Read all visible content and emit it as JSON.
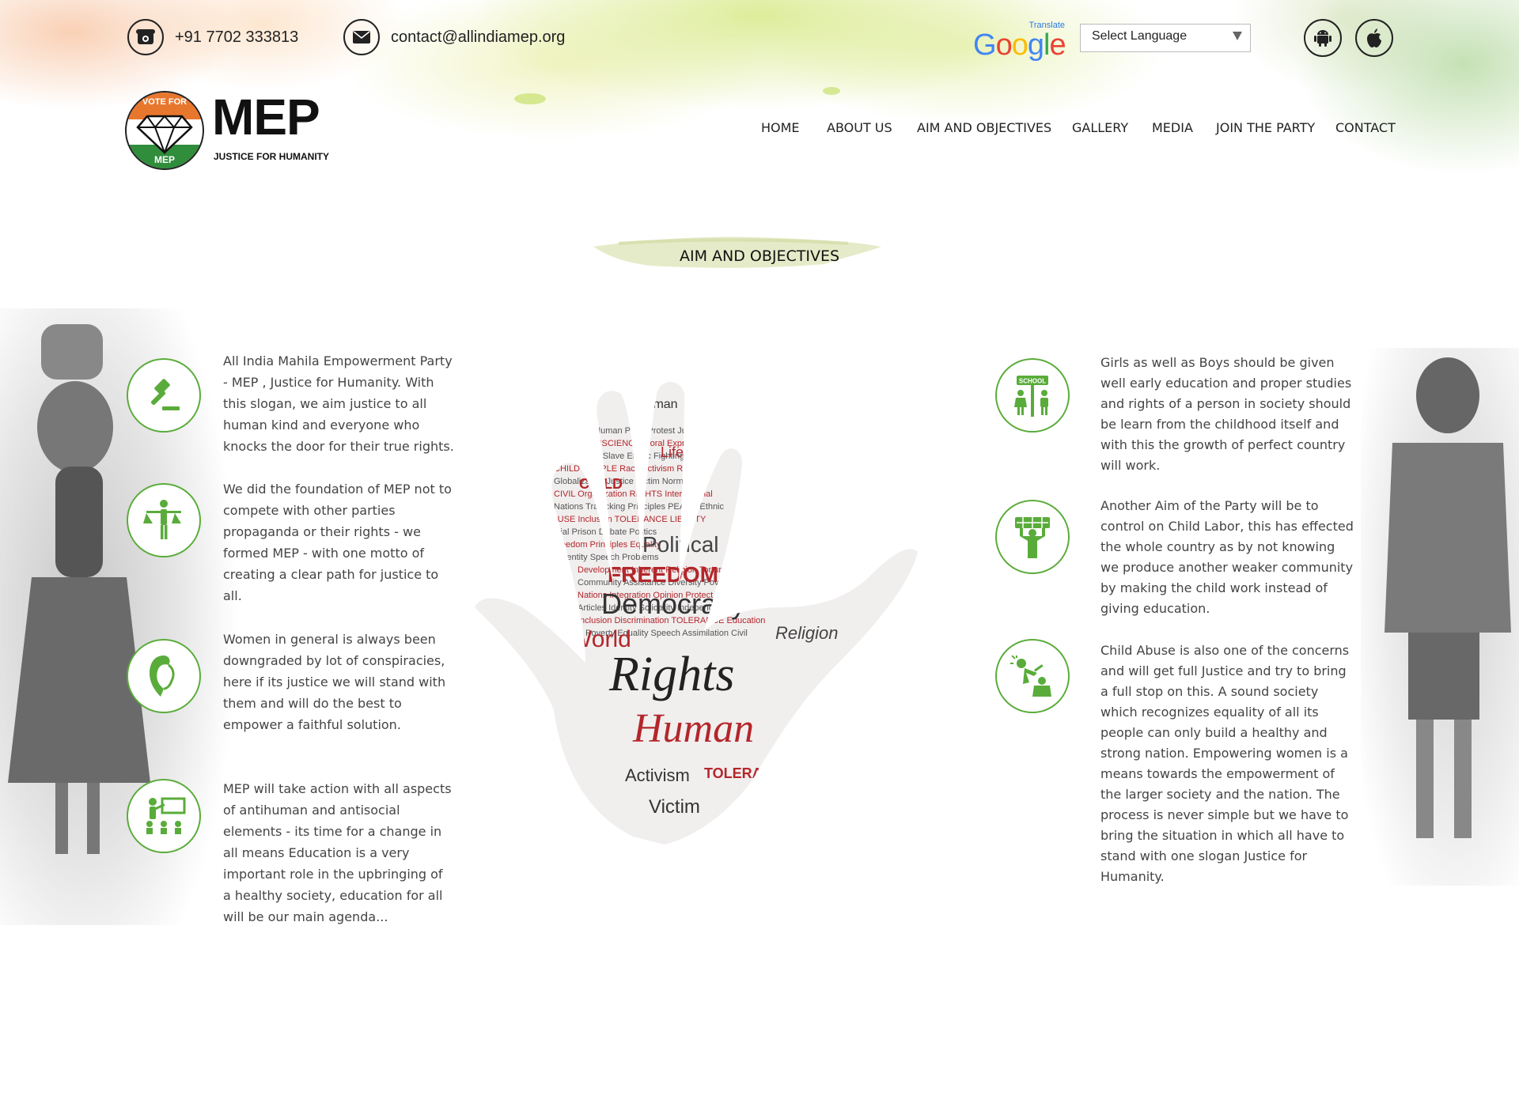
{
  "topbar": {
    "phone": "+91 7702 333813",
    "email": "contact@allindiamep.org",
    "translate_label": "Translate",
    "google_label": "Google",
    "language_select": "Select Language"
  },
  "icons": {
    "phone": "phone-icon",
    "email": "envelope-icon",
    "android": "android-icon",
    "apple": "apple-icon"
  },
  "logo": {
    "vote_for": "VOTE FOR",
    "badge_text": "MEP",
    "name": "MEP",
    "tagline": "JUSTICE FOR HUMANITY"
  },
  "nav": {
    "items": [
      "HOME",
      "ABOUT US",
      "AIM AND OBJECTIVES",
      "GALLERY",
      "MEDIA",
      "JOIN THE PARTY",
      "CONTACT"
    ]
  },
  "section": {
    "title": "AIM AND OBJECTIVES"
  },
  "accent_color": "#5aac3a",
  "left_items": [
    {
      "icon": "gavel-icon",
      "text": "All India Mahila Empowerment Party - MEP , Justice for Humanity. With this slogan, we aim justice to all human kind and everyone who knocks the door for their true rights."
    },
    {
      "icon": "justice-scale-person-icon",
      "text": "We did the foundation of MEP not to compete with other parties propaganda or their rights - we formed MEP - with one motto of creating a clear path for justice to all."
    },
    {
      "icon": "woman-face-icon",
      "text": "Women in general is always been downgraded by lot of conspiracies, here if its justice we will stand with them and will do the best to empower a faithful solution."
    },
    {
      "icon": "classroom-icon",
      "text": "MEP will take action with all aspects of antihuman and antisocial elements - its time for a change in all means Education is a very important role in the upbringing of a healthy society, education for all will be our main agenda..."
    }
  ],
  "right_items": [
    {
      "icon": "school-children-icon",
      "text": "Girls as well as Boys should be given well early education and proper studies and rights of a person in society should be learn from the childhood itself and with this the growth of perfect country will work."
    },
    {
      "icon": "child-labor-icon",
      "text": "Another Aim of the Party will be to control on Child Labor, this has effected the whole country as by not knowing we produce another weaker community by making the child work instead of giving education."
    },
    {
      "icon": "child-abuse-icon",
      "text": "Child Abuse is also one of the concerns and will get full Justice and try to bring a full stop on this. A sound society which recognizes equality of all its people can only build a healthy and strong nation. Empowering women is a means towards the empowerment of the larger society and the nation. The process is never simple but we have to bring the situation in which all have to stand with one slogan Justice for Humanity."
    }
  ],
  "wordcloud": {
    "big": [
      "Rights",
      "Human",
      "Democracy",
      "FREEDOM",
      "Political",
      "World",
      "Victim",
      "LAW",
      "Life",
      "Race",
      "Religion"
    ],
    "red": [
      "CHILD",
      "PEOPLE",
      "CIVIL",
      "Liberty",
      "CONSCIENCE",
      "Activism",
      "Moral",
      "TOLERANCE",
      "Nations",
      "Inclusion"
    ],
    "grey": [
      "SOCIETY",
      "Justice",
      "ABUSE",
      "Principles",
      "Norms",
      "Cultural",
      "Equality",
      "Speech",
      "Ethnic",
      "Poverty"
    ]
  }
}
